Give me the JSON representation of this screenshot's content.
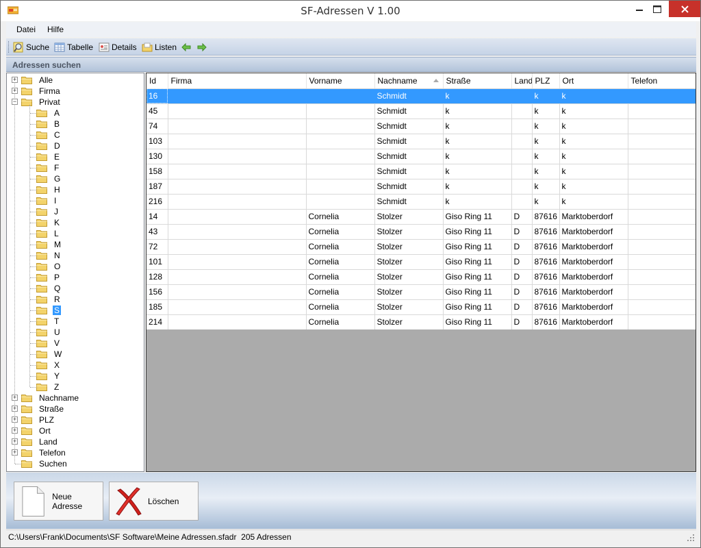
{
  "window": {
    "title": "SF-Adressen  V 1.00"
  },
  "menu": {
    "items": [
      "Datei",
      "Hilfe"
    ]
  },
  "toolbar": {
    "search_label": "Suche",
    "table_label": "Tabelle",
    "details_label": "Details",
    "lists_label": "Listen"
  },
  "section": {
    "title": "Adressen suchen"
  },
  "tree": {
    "top_nodes": [
      "Alle",
      "Firma",
      "Privat"
    ],
    "letters": [
      "A",
      "B",
      "C",
      "D",
      "E",
      "F",
      "G",
      "H",
      "I",
      "J",
      "K",
      "L",
      "M",
      "N",
      "O",
      "P",
      "Q",
      "R",
      "S",
      "T",
      "U",
      "V",
      "W",
      "X",
      "Y",
      "Z"
    ],
    "selected_letter": "S",
    "bottom_nodes": [
      "Nachname",
      "Straße",
      "PLZ",
      "Ort",
      "Land",
      "Telefon",
      "Suchen"
    ]
  },
  "table": {
    "columns": [
      "Id",
      "Firma",
      "Vorname",
      "Nachname",
      "Straße",
      "Land",
      "PLZ",
      "Ort",
      "Telefon"
    ],
    "sort_column": "Nachname",
    "rows": [
      [
        "16",
        "",
        "",
        "Schmidt",
        "k",
        "",
        "k",
        "k",
        ""
      ],
      [
        "45",
        "",
        "",
        "Schmidt",
        "k",
        "",
        "k",
        "k",
        ""
      ],
      [
        "74",
        "",
        "",
        "Schmidt",
        "k",
        "",
        "k",
        "k",
        ""
      ],
      [
        "103",
        "",
        "",
        "Schmidt",
        "k",
        "",
        "k",
        "k",
        ""
      ],
      [
        "130",
        "",
        "",
        "Schmidt",
        "k",
        "",
        "k",
        "k",
        ""
      ],
      [
        "158",
        "",
        "",
        "Schmidt",
        "k",
        "",
        "k",
        "k",
        ""
      ],
      [
        "187",
        "",
        "",
        "Schmidt",
        "k",
        "",
        "k",
        "k",
        ""
      ],
      [
        "216",
        "",
        "",
        "Schmidt",
        "k",
        "",
        "k",
        "k",
        ""
      ],
      [
        "14",
        "",
        "Cornelia",
        "Stolzer",
        "Giso Ring 11",
        "D",
        "87616",
        "Marktoberdorf",
        ""
      ],
      [
        "43",
        "",
        "Cornelia",
        "Stolzer",
        "Giso Ring 11",
        "D",
        "87616",
        "Marktoberdorf",
        ""
      ],
      [
        "72",
        "",
        "Cornelia",
        "Stolzer",
        "Giso Ring 11",
        "D",
        "87616",
        "Marktoberdorf",
        ""
      ],
      [
        "101",
        "",
        "Cornelia",
        "Stolzer",
        "Giso Ring 11",
        "D",
        "87616",
        "Marktoberdorf",
        ""
      ],
      [
        "128",
        "",
        "Cornelia",
        "Stolzer",
        "Giso Ring 11",
        "D",
        "87616",
        "Marktoberdorf",
        ""
      ],
      [
        "156",
        "",
        "Cornelia",
        "Stolzer",
        "Giso Ring 11",
        "D",
        "87616",
        "Marktoberdorf",
        ""
      ],
      [
        "185",
        "",
        "Cornelia",
        "Stolzer",
        "Giso Ring 11",
        "D",
        "87616",
        "Marktoberdorf",
        ""
      ],
      [
        "214",
        "",
        "Cornelia",
        "Stolzer",
        "Giso Ring 11",
        "D",
        "87616",
        "Marktoberdorf",
        ""
      ]
    ],
    "selected_row": 0
  },
  "buttons": {
    "new_label": "Neue Adresse",
    "delete_label": "Löschen"
  },
  "status": {
    "path": "C:\\Users\\Frank\\Documents\\SF Software\\Meine Adressen.sfadr",
    "count": "205 Adressen"
  },
  "colors": {
    "selection": "#3399ff",
    "close": "#c7312a"
  }
}
